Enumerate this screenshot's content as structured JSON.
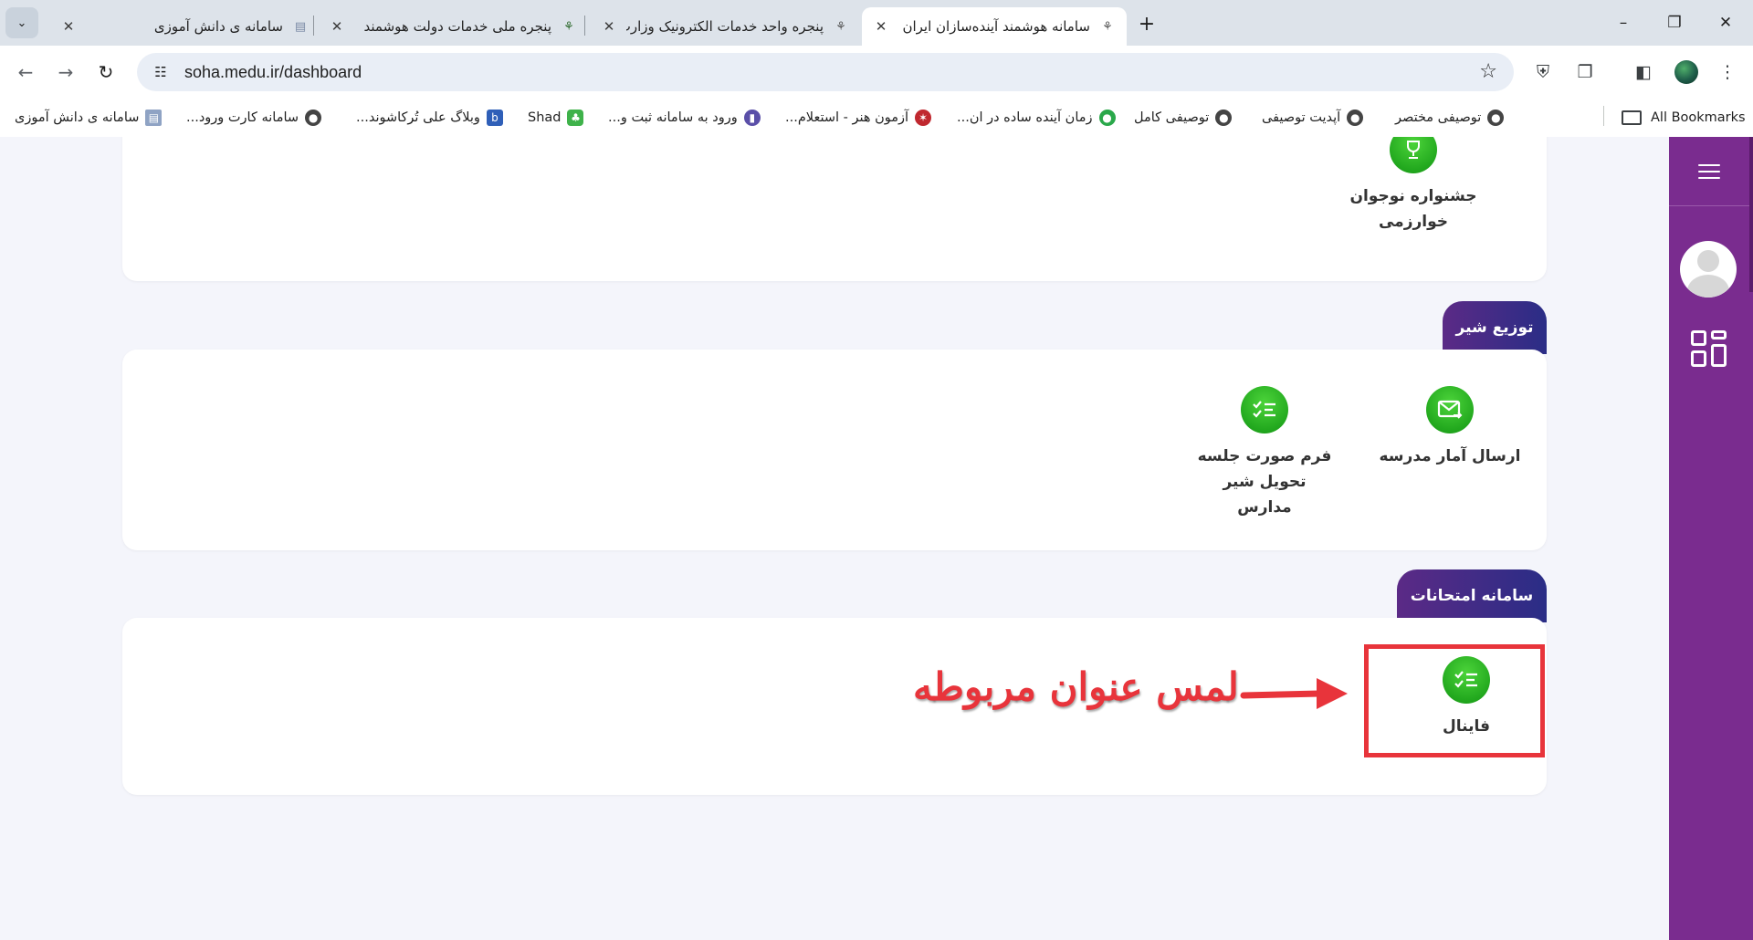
{
  "browser": {
    "tabs": [
      {
        "title": "سامانه ی دانش آموزی",
        "active": false
      },
      {
        "title": "پنجره ملی خدمات دولت هوشمند",
        "active": false
      },
      {
        "title": "پنجره واحد خدمات الکترونیک وزارت",
        "active": false
      },
      {
        "title": "سامانه هوشمند آینده‌سازان ایران",
        "active": true
      }
    ],
    "url": "soha.medu.ir/dashboard",
    "bookmarks": [
      {
        "title": "توصیفی مختصر"
      },
      {
        "title": "آپدیت توصیفی"
      },
      {
        "title": "توصیفی کامل"
      },
      {
        "title": "زمان آینده ساده در ان..."
      },
      {
        "title": "آزمون هنر - استعلام..."
      },
      {
        "title": "ورود به سامانه ثبت و..."
      },
      {
        "title": "Shad"
      },
      {
        "title": "وبلاگ علی تُرکاشوند..."
      },
      {
        "title": "سامانه کارت ورود..."
      },
      {
        "title": "سامانه ی دانش آموزی"
      }
    ],
    "all_bookmarks": "All Bookmarks"
  },
  "sections": {
    "kharazmi": {
      "label": "جشنواره نوجوان خوارزمی"
    },
    "milk": {
      "title": "توزیع شیر",
      "items": [
        {
          "label": "ارسال آمار مدرسه",
          "icon": "mail-icon"
        },
        {
          "label": "فرم صورت جلسه تحویل شیر مدارس",
          "icon": "checklist-icon"
        }
      ]
    },
    "exams": {
      "title": "سامانه امتحانات",
      "items": [
        {
          "label": "فاینال",
          "icon": "checklist-icon"
        }
      ]
    }
  },
  "annotation": {
    "text": "لمس عنوان مربوطه",
    "color": "#e8343b"
  },
  "colors": {
    "sidebar": "#7a2c8f",
    "accent_green": "#22a81e",
    "tab_gradient_start": "#5b2a86",
    "tab_gradient_end": "#2a2d86"
  }
}
